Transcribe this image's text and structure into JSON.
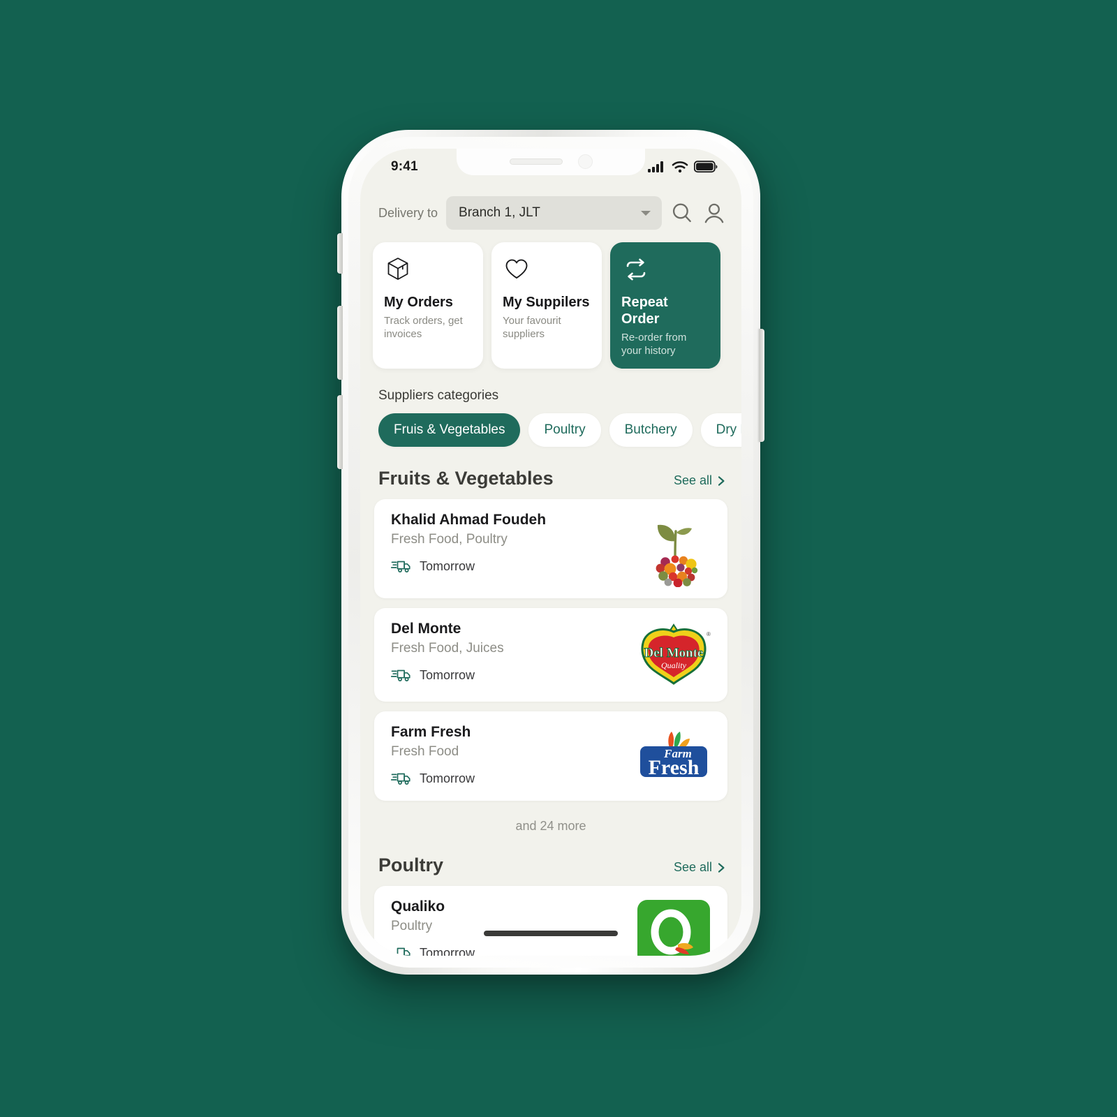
{
  "theme": {
    "page_background": "#136150",
    "accent": "#1f6b5c",
    "screen_background": "#f2f2ec",
    "card_background": "#ffffff"
  },
  "status_bar": {
    "time": "9:41",
    "icons": [
      "cellular-signal-icon",
      "wifi-icon",
      "battery-icon"
    ]
  },
  "header": {
    "delivery_label": "Delivery to",
    "branch_value": "Branch 1, JLT",
    "icons": [
      "search-icon",
      "profile-icon"
    ]
  },
  "action_cards": [
    {
      "icon": "package-box-icon",
      "title": "My Orders",
      "subtitle": "Track orders, get invoices",
      "accent": false
    },
    {
      "icon": "heart-icon",
      "title": "My Suppilers",
      "subtitle": "Your favourit suppliers",
      "accent": false
    },
    {
      "icon": "repeat-icon",
      "title": "Repeat Order",
      "subtitle": "Re-order from your history",
      "accent": true
    }
  ],
  "categories": {
    "title": "Suppliers categories",
    "chips": [
      {
        "label": "Fruis & Vegetables",
        "active": true
      },
      {
        "label": "Poultry",
        "active": false
      },
      {
        "label": "Butchery",
        "active": false
      },
      {
        "label": "Dry F",
        "active": false
      }
    ]
  },
  "sections": [
    {
      "title": "Fruits & Vegetables",
      "see_all": "See all",
      "and_more": "and 24 more",
      "suppliers": [
        {
          "name": "Khalid Ahmad Foudeh",
          "categories": "Fresh Food, Poultry",
          "delivery": "Tomorrow",
          "logo": "sprout-fruit-mosaic-logo"
        },
        {
          "name": "Del Monte",
          "categories": "Fresh Food, Juices",
          "delivery": "Tomorrow",
          "logo": "del-monte-shield-logo",
          "logo_text": "Del Monte",
          "logo_subtext": "Quality"
        },
        {
          "name": "Farm Fresh",
          "categories": "Fresh Food",
          "delivery": "Tomorrow",
          "logo": "farm-fresh-logo",
          "logo_text": "Farm",
          "logo_subtext": "Fresh"
        }
      ]
    },
    {
      "title": "Poultry",
      "see_all": "See all",
      "suppliers": [
        {
          "name": "Qualiko",
          "categories": "Poultry",
          "delivery": "Tomorrow",
          "logo": "qualiko-q-logo",
          "logo_text": "Q"
        }
      ]
    }
  ]
}
